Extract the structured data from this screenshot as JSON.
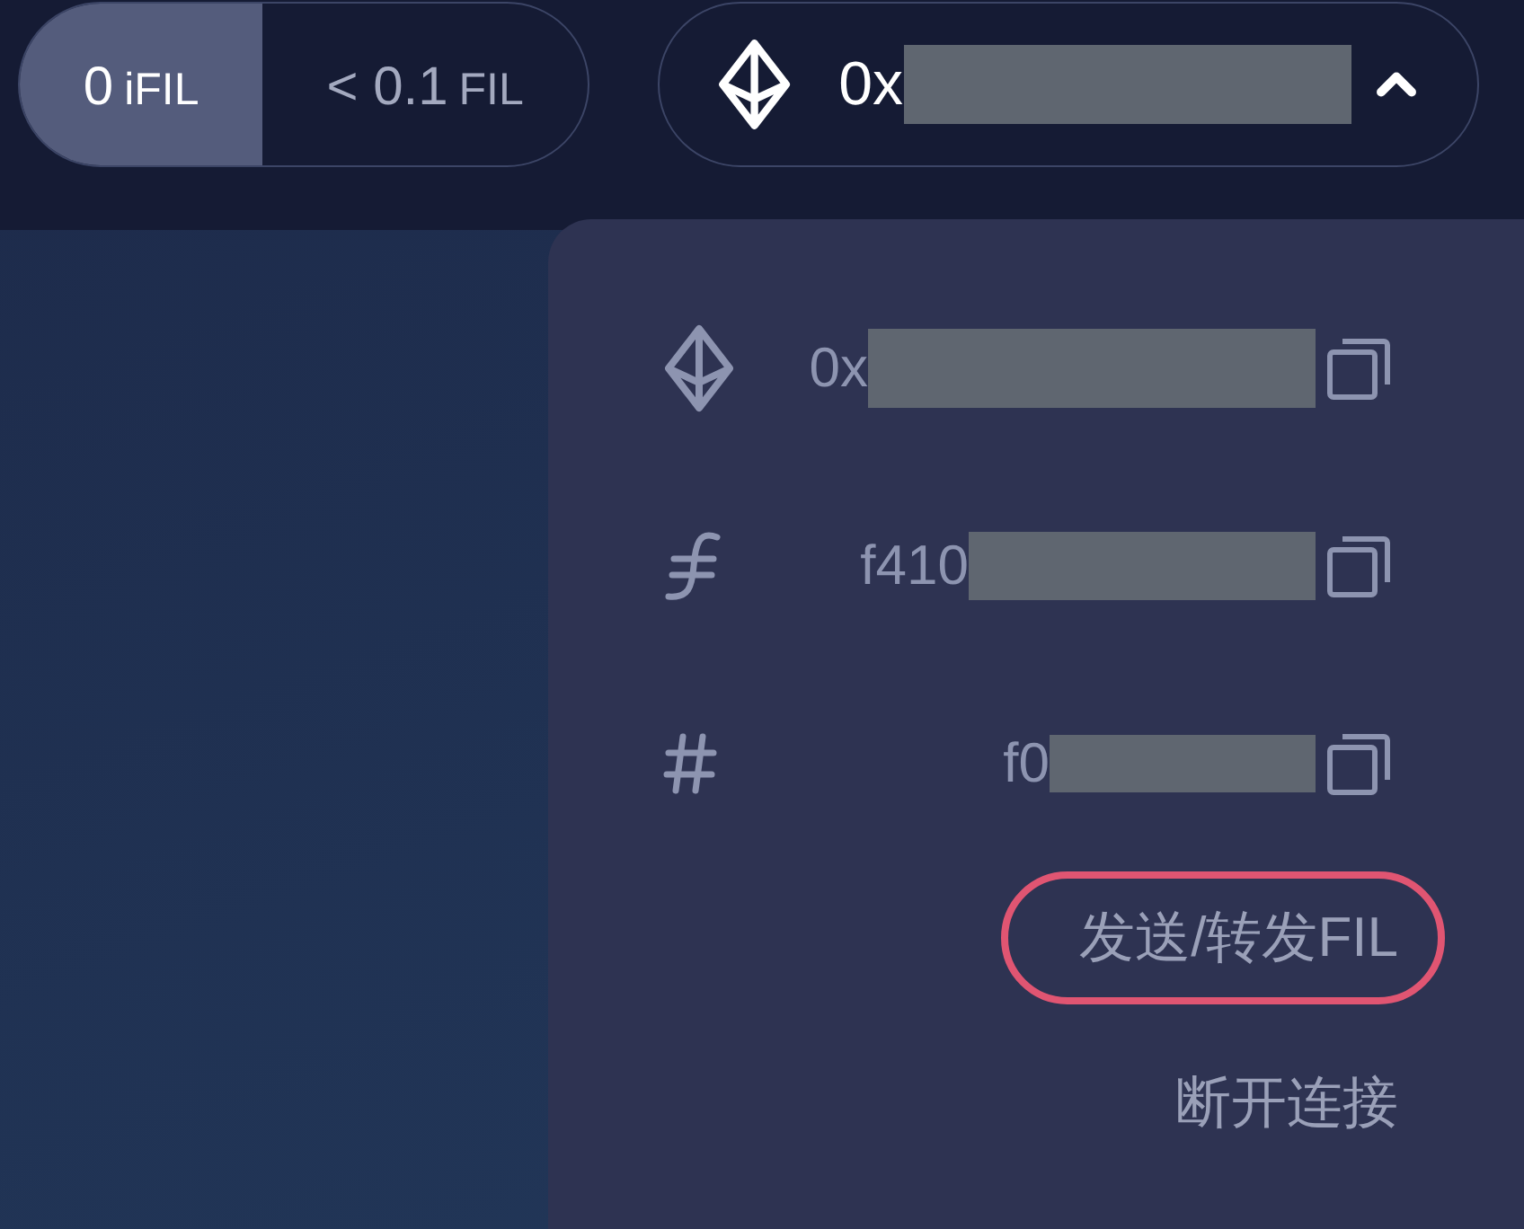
{
  "balances": [
    {
      "amount": "0",
      "unit": "iFIL",
      "selected": true
    },
    {
      "amount": "< 0.1",
      "unit": "FIL",
      "selected": false
    }
  ],
  "account": {
    "address": "0x",
    "expanded": true
  },
  "addresses": [
    {
      "kind": "eth",
      "text": "0x"
    },
    {
      "kind": "fil",
      "text": "f410"
    },
    {
      "kind": "id",
      "text": "f0"
    }
  ],
  "actions": [
    {
      "label": "发送/转发FIL",
      "highlighted": true
    },
    {
      "label": "断开连接",
      "highlighted": false
    }
  ]
}
